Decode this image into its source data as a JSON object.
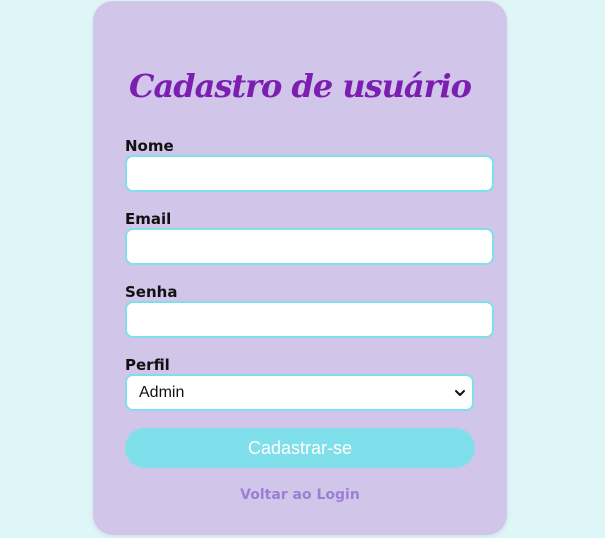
{
  "form": {
    "title": "Cadastro de usuário",
    "fields": {
      "name": {
        "label": "Nome",
        "value": ""
      },
      "email": {
        "label": "Email",
        "value": ""
      },
      "password": {
        "label": "Senha",
        "value": ""
      },
      "profile": {
        "label": "Perfil",
        "selected": "Admin",
        "icon": "chevron-down-icon"
      }
    },
    "submit_label": "Cadastrar-se",
    "back_link_label": "Voltar ao Login"
  },
  "colors": {
    "background": "#dff6f8",
    "card": "#d2c5ea",
    "title": "#7a1fb0",
    "accent": "#7fdfea",
    "link": "#9b7fd4"
  }
}
